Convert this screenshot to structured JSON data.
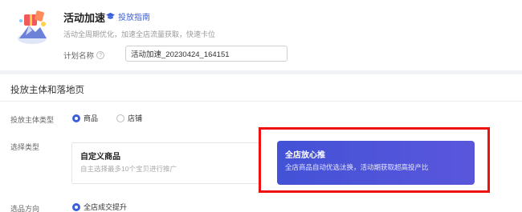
{
  "header": {
    "title": "活动加速",
    "guide_link": "投放指南",
    "subtitle": "活动全周期优化，加速全店流量获取，快速卡位",
    "plan_name_label": "计划名称",
    "plan_name_value": "活动加速_20230424_164151"
  },
  "section": {
    "title": "投放主体和落地页"
  },
  "subject_type": {
    "label": "投放主体类型",
    "options": [
      {
        "label": "商品",
        "selected": true
      },
      {
        "label": "店铺",
        "selected": false
      }
    ]
  },
  "select_type": {
    "label": "选择类型",
    "cards": [
      {
        "title": "自定义商品",
        "desc": "自主选择最多10个宝贝进行推广",
        "selected": false
      },
      {
        "title": "全店放心推",
        "desc": "全店商品自动优选汰换，活动期获取超高投产比",
        "selected": true
      }
    ]
  },
  "direction": {
    "label": "选品方向",
    "option": "全店成交提升"
  },
  "colors": {
    "accent": "#3a5fd9",
    "highlight_box": "#ee1111",
    "active_card": "#4a54d8"
  }
}
